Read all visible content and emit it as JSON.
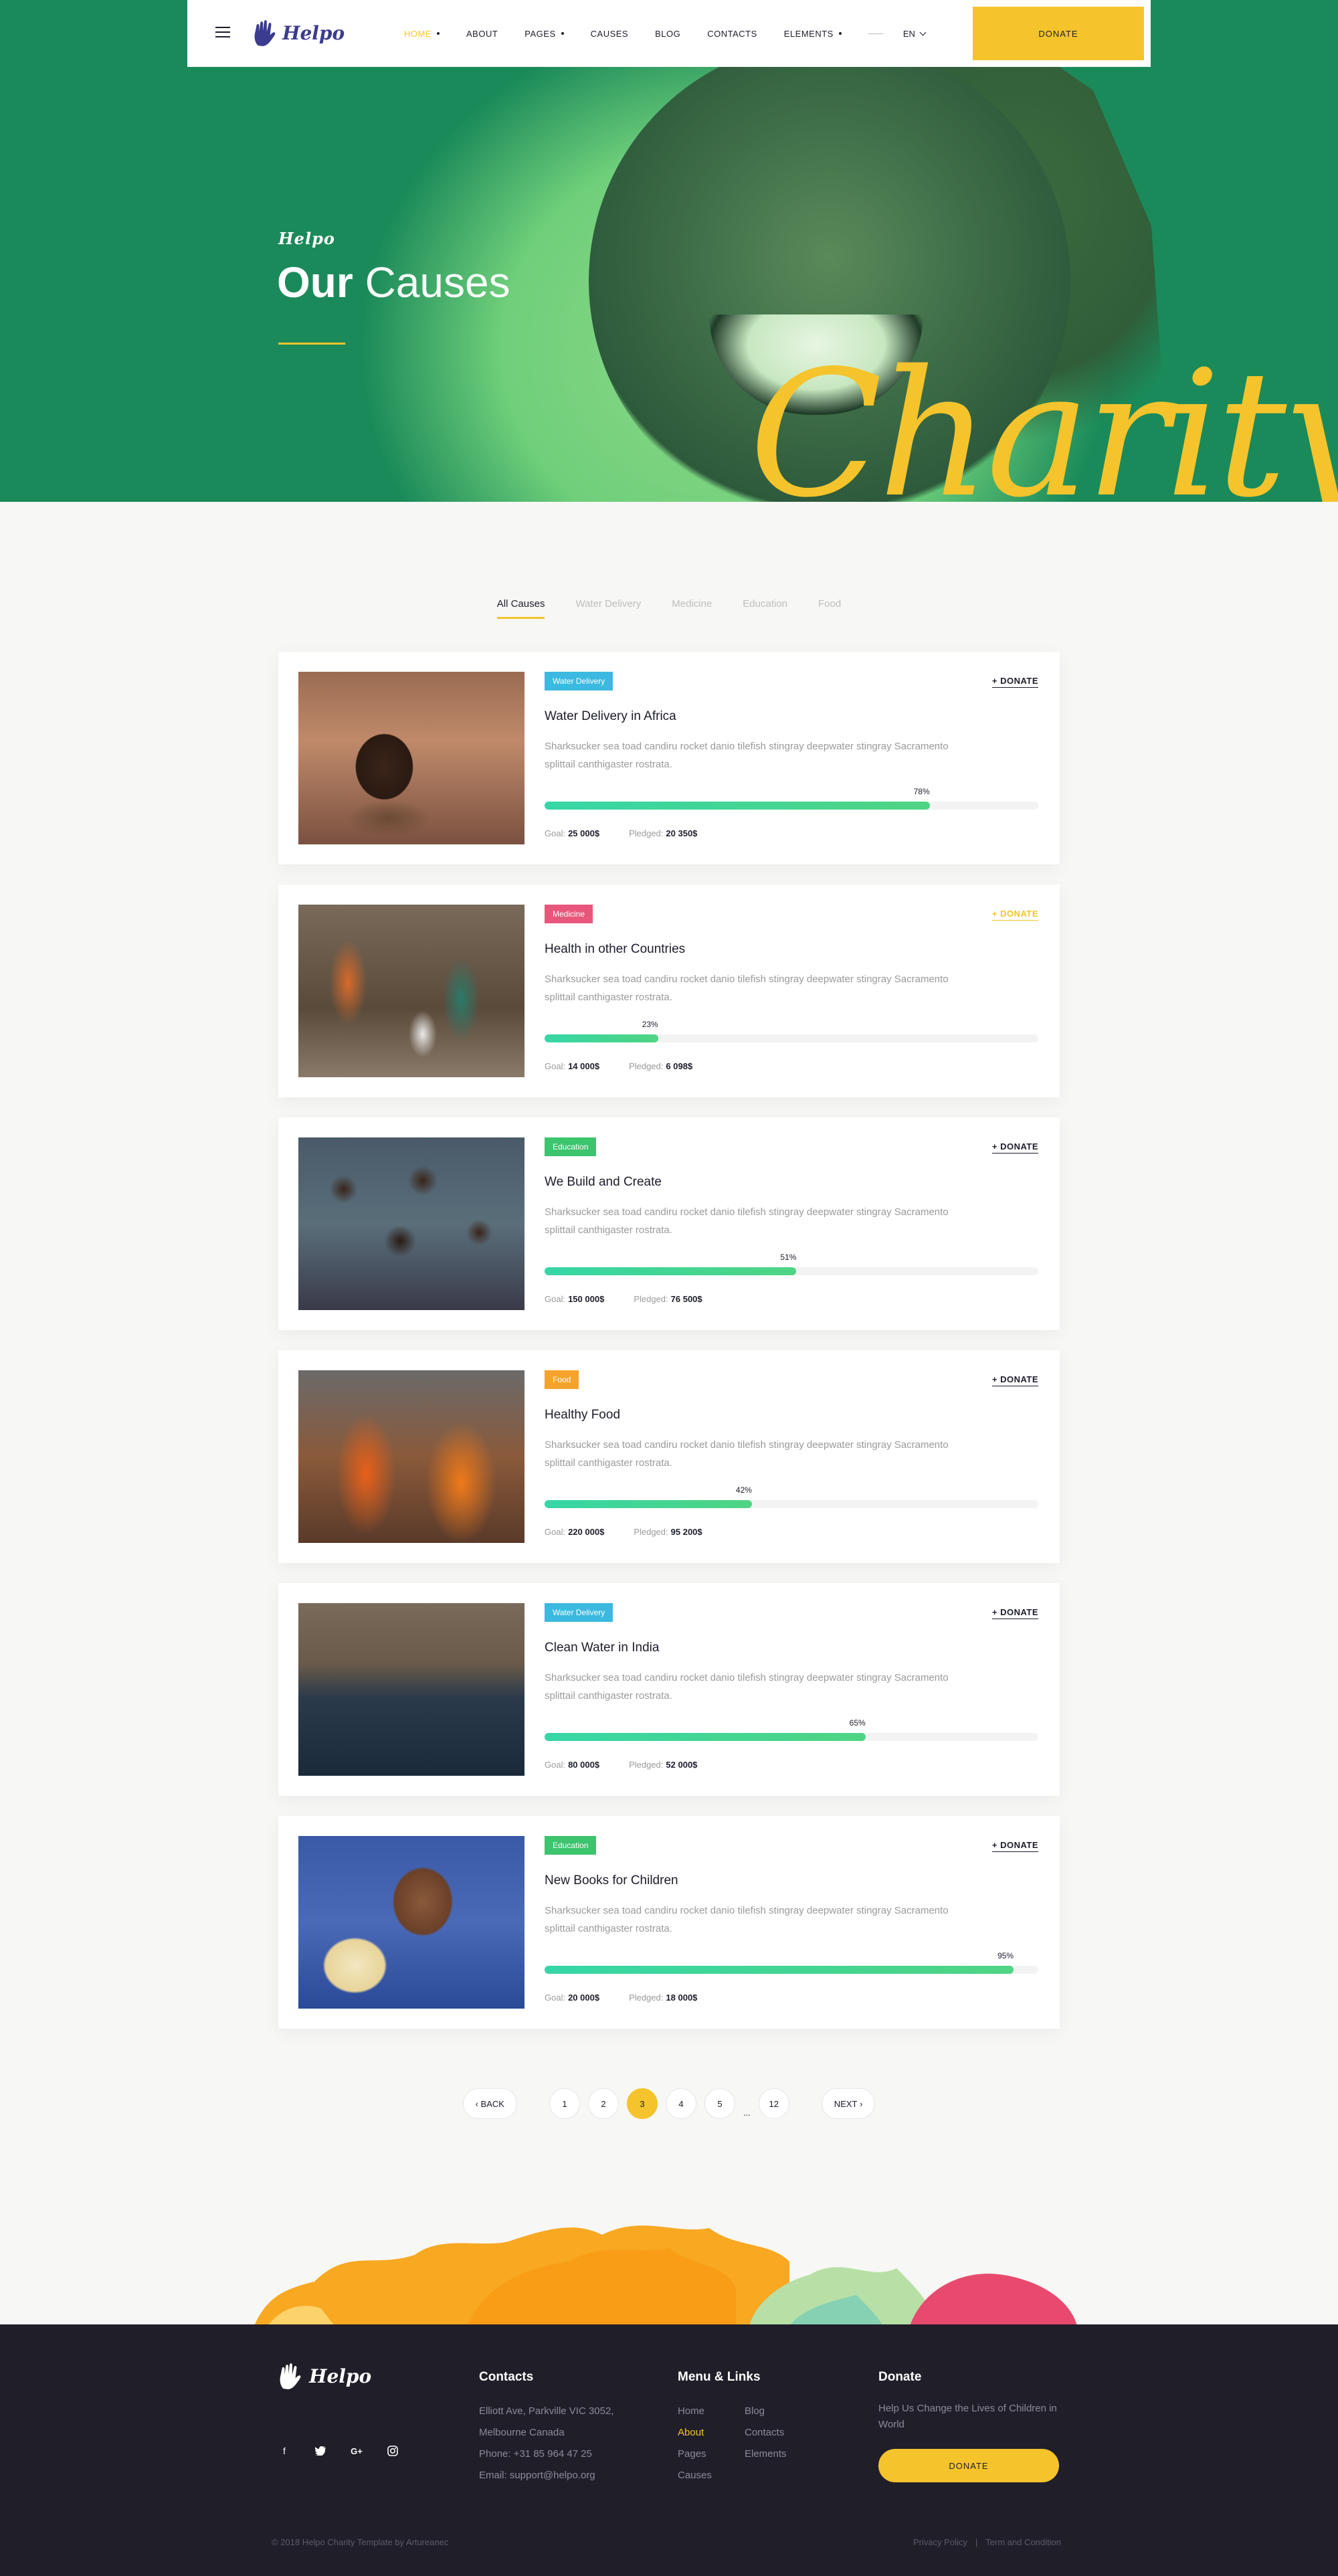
{
  "header": {
    "brand": "Helpo",
    "nav": [
      {
        "label": "HOME",
        "active": true,
        "dropdown": true
      },
      {
        "label": "ABOUT",
        "active": false,
        "dropdown": false
      },
      {
        "label": "PAGES",
        "active": false,
        "dropdown": true
      },
      {
        "label": "CAUSES",
        "active": false,
        "dropdown": false
      },
      {
        "label": "BLOG",
        "active": false,
        "dropdown": false
      },
      {
        "label": "CONTACTS",
        "active": false,
        "dropdown": false
      },
      {
        "label": "ELEMENTS",
        "active": false,
        "dropdown": true
      }
    ],
    "language": "EN",
    "donate_label": "DONATE"
  },
  "hero": {
    "brand": "Helpo",
    "title_bold": "Our",
    "title_light": "Causes",
    "script": "Charity"
  },
  "filters": {
    "tabs": [
      "All Causes",
      "Water Delivery",
      "Medicine",
      "Education",
      "Food"
    ],
    "active": "All Causes"
  },
  "causes": [
    {
      "tag": "Water Delivery",
      "tag_color": "#3bb9e0",
      "title": "Water Delivery in Africa",
      "description": "Sharksucker sea toad candiru rocket danio tilefish stingray deepwater stingray Sacramento splittail canthigaster rostrata.",
      "progress": 78,
      "progress_label": "78%",
      "goal_label": "Goal:",
      "goal": "25 000$",
      "pledged_label": "Pledged:",
      "pledged": "20 350$",
      "donate_label": "+ DONATE",
      "donate_highlight": false,
      "image": "child-at-rail"
    },
    {
      "tag": "Medicine",
      "tag_color": "#e8577b",
      "title": "Health in other Countries",
      "description": "Sharksucker sea toad candiru rocket danio tilefish stingray deepwater stingray Sacramento splittail canthigaster rostrata.",
      "progress": 23,
      "progress_label": "23%",
      "goal_label": "Goal:",
      "goal": "14 000$",
      "pledged_label": "Pledged:",
      "pledged": "6 098$",
      "donate_label": "+ DONATE",
      "donate_highlight": true,
      "image": "village-women"
    },
    {
      "tag": "Education",
      "tag_color": "#3cc46e",
      "title": "We Build and Create",
      "description": "Sharksucker sea toad candiru rocket danio tilefish stingray deepwater stingray Sacramento splittail canthigaster rostrata.",
      "progress": 51,
      "progress_label": "51%",
      "goal_label": "Goal:",
      "goal": "150 000$",
      "pledged_label": "Pledged:",
      "pledged": "76 500$",
      "donate_label": "+ DONATE",
      "donate_highlight": false,
      "image": "group-of-children"
    },
    {
      "tag": "Food",
      "tag_color": "#f5a32c",
      "title": "Healthy Food",
      "description": "Sharksucker sea toad candiru rocket danio tilefish stingray deepwater stingray Sacramento splittail canthigaster rostrata.",
      "progress": 42,
      "progress_label": "42%",
      "goal_label": "Goal:",
      "goal": "220 000$",
      "pledged_label": "Pledged:",
      "pledged": "95 200$",
      "donate_label": "+ DONATE",
      "donate_highlight": false,
      "image": "women-in-orange"
    },
    {
      "tag": "Water Delivery",
      "tag_color": "#3bb9e0",
      "title": "Clean Water in India",
      "description": "Sharksucker sea toad candiru rocket danio tilefish stingray deepwater stingray Sacramento splittail canthigaster rostrata.",
      "progress": 65,
      "progress_label": "65%",
      "goal_label": "Goal:",
      "goal": "80 000$",
      "pledged_label": "Pledged:",
      "pledged": "52 000$",
      "donate_label": "+ DONATE",
      "donate_highlight": false,
      "image": "river-ghats"
    },
    {
      "tag": "Education",
      "tag_color": "#3cc46e",
      "title": "New Books for Children",
      "description": "Sharksucker sea toad candiru rocket danio tilefish stingray deepwater stingray Sacramento splittail canthigaster rostrata.",
      "progress": 95,
      "progress_label": "95%",
      "goal_label": "Goal:",
      "goal": "20 000$",
      "pledged_label": "Pledged:",
      "pledged": "18 000$",
      "donate_label": "+ DONATE",
      "donate_highlight": false,
      "image": "girl-with-book"
    }
  ],
  "pagination": {
    "back": "BACK",
    "pages": [
      "1",
      "2",
      "3",
      "4",
      "5"
    ],
    "current": "3",
    "ellipsis": "...",
    "last": "12",
    "next": "NEXT"
  },
  "footer": {
    "brand": "Helpo",
    "social": [
      "facebook-icon",
      "twitter-icon",
      "google-plus-icon",
      "instagram-icon"
    ],
    "contacts": {
      "heading": "Contacts",
      "lines": [
        "Elliott Ave, Parkville VIC 3052,",
        "Melbourne Canada",
        "Phone: +31 85 964 47 25",
        "Email: support@helpo.org"
      ]
    },
    "menu": {
      "heading": "Menu & Links",
      "links": [
        "Home",
        "Blog",
        "About",
        "Contacts",
        "Pages",
        "Elements",
        "Causes"
      ],
      "active": "About"
    },
    "donate": {
      "heading": "Donate",
      "text": "Help Us Change the Lives of Children in World",
      "button": "DONATE"
    },
    "copyright": "© 2018 Helpo Charity Template by Artureanec",
    "legal": [
      "Privacy Policy",
      "|",
      "Term and Condition"
    ]
  },
  "colors": {
    "accent": "#f5c42c",
    "hero_green": "#1b8a5a",
    "progress": "#4fd483",
    "footer_bg": "#1f1e29"
  }
}
